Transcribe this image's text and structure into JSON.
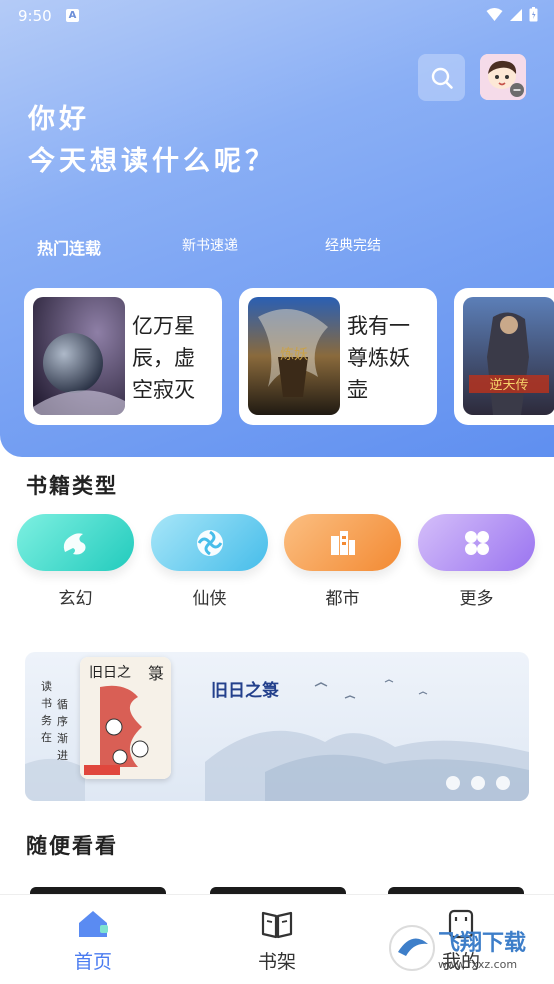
{
  "status_bar": {
    "time": "9:50",
    "badge": "A"
  },
  "header": {
    "greeting_line1": "你好",
    "greeting_line2": "今天想读什么呢？",
    "search_icon": "search-icon",
    "avatar_icon": "avatar-icon"
  },
  "hot_tabs": [
    {
      "label": "热门连载",
      "active": true
    },
    {
      "label": "新书速递",
      "active": false
    },
    {
      "label": "经典完结",
      "active": false
    }
  ],
  "hot_books": [
    {
      "title": "亿万星辰，虚空寂灭"
    },
    {
      "title": "我有一尊炼妖壶"
    },
    {
      "title": ""
    }
  ],
  "categories_section": {
    "title": "书籍类型",
    "items": [
      {
        "label": "玄幻",
        "icon": "dragon-icon",
        "color": "#2ed3c6"
      },
      {
        "label": "仙侠",
        "icon": "swirl-icon",
        "color": "#5cc6ee"
      },
      {
        "label": "都市",
        "icon": "city-icon",
        "color": "#f7913e"
      },
      {
        "label": "更多",
        "icon": "grid-icon",
        "color": "#a57ef3"
      }
    ]
  },
  "banner": {
    "title": "旧日之箓",
    "vertical_text": [
      "读书务在",
      "循序渐进"
    ],
    "cover_title": "旧日之箓"
  },
  "random_section": {
    "title": "随便看看"
  },
  "bottom_nav": [
    {
      "label": "首页",
      "icon": "home-icon",
      "active": true,
      "color": "#4b7cf0"
    },
    {
      "label": "书架",
      "icon": "book-icon",
      "active": false,
      "color": "#333333"
    },
    {
      "label": "我的",
      "icon": "user-icon",
      "active": false,
      "color": "#333333"
    }
  ],
  "watermark": {
    "text": "飞翔下载",
    "url": "www.fxxz.com"
  }
}
